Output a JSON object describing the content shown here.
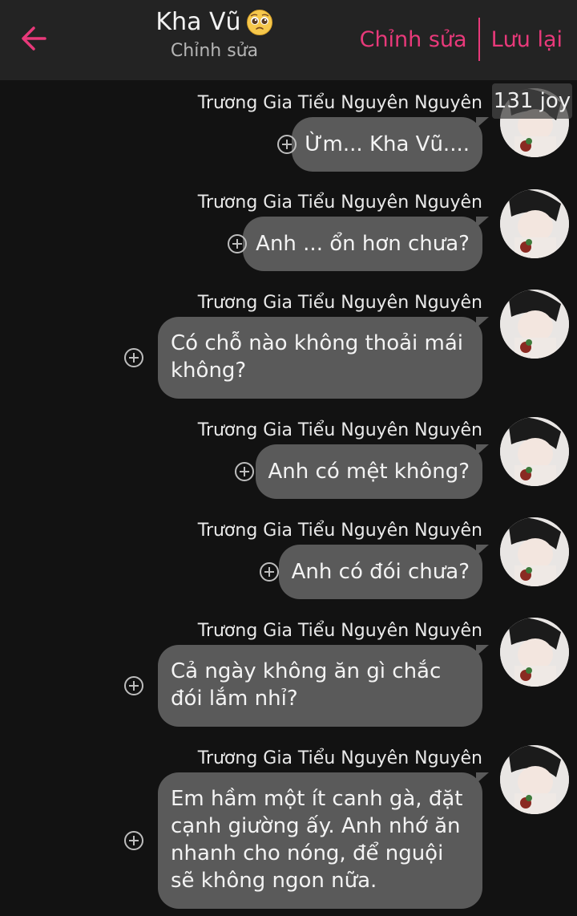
{
  "header": {
    "title": "Kha Vũ",
    "title_emoji": "pleading-face-icon",
    "subtitle": "Chỉnh sửa",
    "edit_label": "Chỉnh sửa",
    "save_label": "Lưu lại",
    "accent": "#e8397a"
  },
  "badge": {
    "text": "131 joy"
  },
  "messages": [
    {
      "sender": "Trương Gia Tiểu Nguyên Nguyên",
      "text": "Ừm... Kha Vũ...."
    },
    {
      "sender": "Trương Gia Tiểu Nguyên Nguyên",
      "text": "Anh ... ổn hơn chưa?"
    },
    {
      "sender": "Trương Gia Tiểu Nguyên Nguyên",
      "text": "Có chỗ nào không thoải mái không?"
    },
    {
      "sender": "Trương Gia Tiểu Nguyên Nguyên",
      "text": "Anh có mệt không?"
    },
    {
      "sender": "Trương Gia Tiểu Nguyên Nguyên",
      "text": "Anh có đói chưa?"
    },
    {
      "sender": "Trương Gia Tiểu Nguyên Nguyên",
      "text": "Cả ngày không ăn gì chắc đói lắm nhỉ?"
    },
    {
      "sender": "Trương Gia Tiểu Nguyên Nguyên",
      "text": "Em hầm một ít canh gà, đặt cạnh giường ấy. Anh nhớ ăn nhanh cho nóng, để nguội sẽ không ngon nữa."
    }
  ]
}
